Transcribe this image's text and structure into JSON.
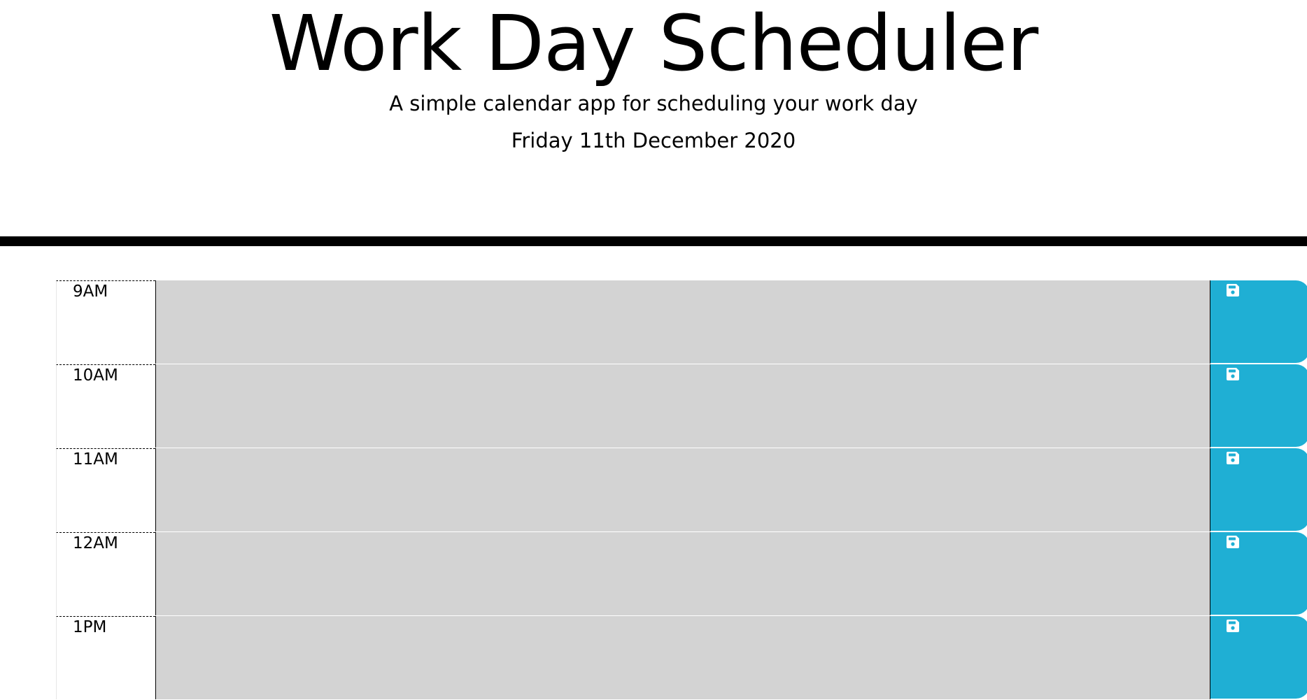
{
  "header": {
    "title": "Work Day Scheduler",
    "subtitle": "A simple calendar app for scheduling your work day",
    "date": "Friday 11th December 2020"
  },
  "schedule": {
    "rows": [
      {
        "hour": "9AM",
        "task": "",
        "save_icon": "floppy-disk-icon"
      },
      {
        "hour": "10AM",
        "task": "",
        "save_icon": "floppy-disk-icon"
      },
      {
        "hour": "11AM",
        "task": "",
        "save_icon": "floppy-disk-icon"
      },
      {
        "hour": "12AM",
        "task": "",
        "save_icon": "floppy-disk-icon"
      },
      {
        "hour": "1PM",
        "task": "",
        "save_icon": "floppy-disk-icon"
      }
    ]
  },
  "colors": {
    "past_block": "#d3d3d3",
    "save_button": "#1fafd4",
    "divider": "#000000"
  }
}
